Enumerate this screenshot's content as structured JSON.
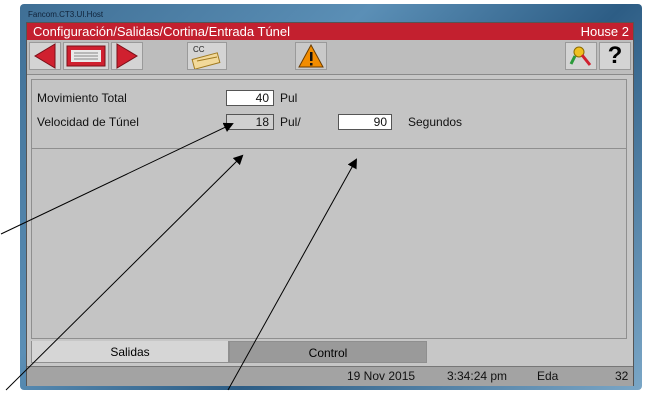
{
  "window": {
    "title": "Fancom.CT3.UI.Host"
  },
  "header": {
    "path": "Configuración/Salidas/Cortina/Entrada Túnel",
    "house": "House 2"
  },
  "toolbar": {
    "cc_label": "CC",
    "help_label": "?"
  },
  "form": {
    "total_movement": {
      "label": "Movimiento Total",
      "value": "40",
      "unit": "Pul"
    },
    "tunnel_speed": {
      "label": "Velocidad de Túnel",
      "value": "18",
      "unit": "Pul/",
      "seconds_value": "90",
      "seconds_unit": "Segundos"
    }
  },
  "tabs": [
    {
      "label": "Salidas"
    },
    {
      "label": "Control"
    }
  ],
  "status": {
    "date": "19 Nov 2015",
    "time": "3:34:24 pm",
    "user": "Eda",
    "number": "32"
  },
  "colors": {
    "header_bg": "#c3202f",
    "nav_arrow": "#d0202f",
    "warning": "#f28c00"
  }
}
